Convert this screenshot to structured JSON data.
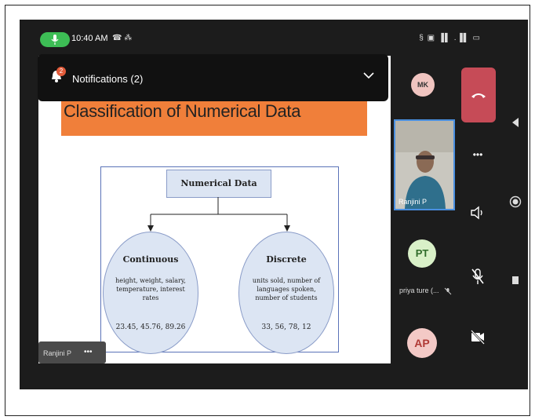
{
  "status_bar": {
    "time": "10:40 AM",
    "call_icons": "☎ ⁂",
    "right_icons": "§ ▣ ▐▌ .▐▌ ▭"
  },
  "notifications": {
    "label": "Notifications (2)",
    "count": "2"
  },
  "slide": {
    "title": "Classification of Numerical Data",
    "root": "Numerical Data",
    "continuous": {
      "heading": "Continuous",
      "desc": "height, weight, salary, temperature, interest rates",
      "values": "23.45, 45.76, 89.26"
    },
    "discrete": {
      "heading": "Discrete",
      "desc": "units sold, number of languages spoken, number of students",
      "values": "33, 56, 78, 12"
    }
  },
  "presenter_tag": {
    "name": "Ranjini P",
    "more": "•••"
  },
  "participants": [
    {
      "initials": "MK",
      "color": "#f0c4c0",
      "text_color": "#333"
    },
    {
      "name": "Ranjini P",
      "video": true
    },
    {
      "initials": "PT",
      "name": "priya ture (...",
      "color": "#d9f0c8",
      "text_color": "#2f6b2a"
    },
    {
      "initials": "AP",
      "color": "#f3c9c6",
      "text_color": "#b03a36"
    }
  ],
  "controls": {
    "more": "•••"
  },
  "colors": {
    "accent_green": "#3dbd55",
    "end_call": "#c64b57",
    "slide_title_bg": "#f07f3a",
    "active_border": "#4a8fe0"
  }
}
